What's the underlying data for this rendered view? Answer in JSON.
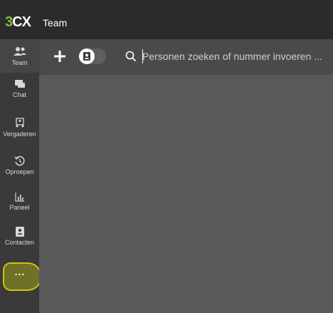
{
  "app": {
    "logo_prefix": "3",
    "logo_suffix": "CX",
    "title": "Team"
  },
  "sidebar": {
    "items": [
      {
        "label": "Team",
        "icon": "people-icon"
      },
      {
        "label": "Chat",
        "icon": "chat-icon"
      },
      {
        "label": "Vergaderen",
        "icon": "meeting-icon"
      },
      {
        "label": "Oproepen",
        "icon": "history-icon"
      },
      {
        "label": "Paneel",
        "icon": "chart-icon"
      },
      {
        "label": "Contacten",
        "icon": "contact-icon"
      }
    ],
    "more_label": "..."
  },
  "toolbar": {
    "search_placeholder": "Personen zoeken of nummer invoeren ..."
  },
  "colors": {
    "logo_accent": "#7fbf3f",
    "highlight": "#e6e600"
  }
}
